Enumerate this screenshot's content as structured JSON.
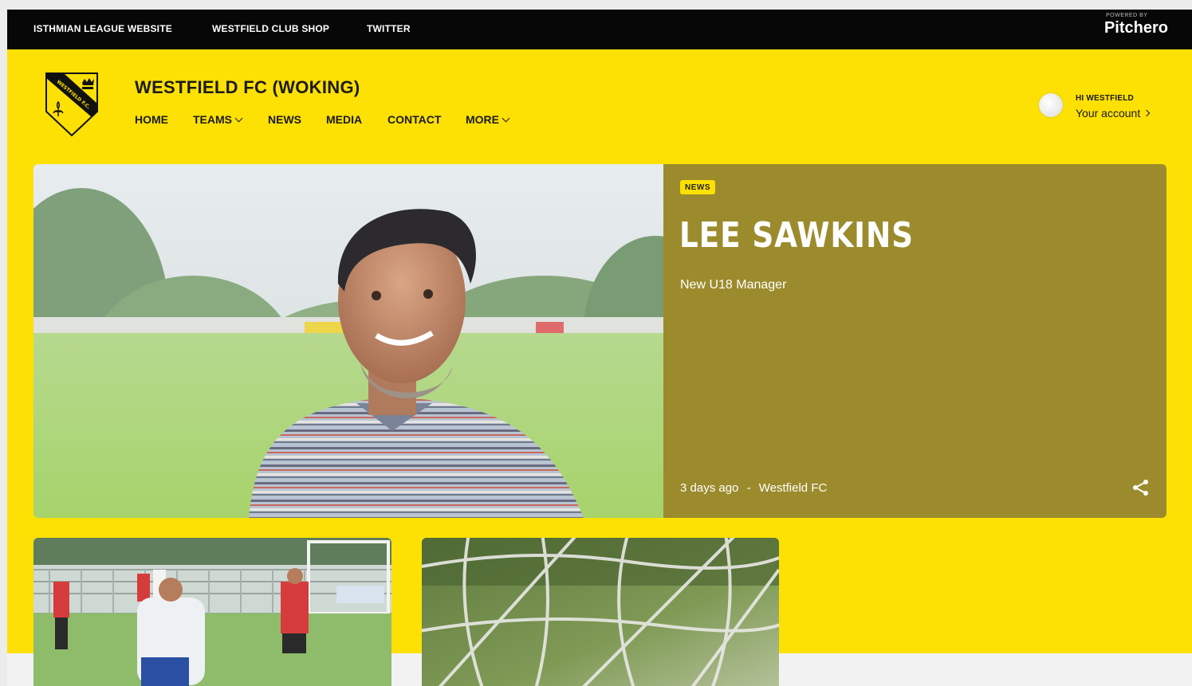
{
  "topbar": {
    "links": [
      "ISTHMIAN LEAGUE WEBSITE",
      "WESTFIELD CLUB SHOP",
      "TWITTER"
    ],
    "powered_by": "POWERED BY",
    "brand": "Pitchero"
  },
  "header": {
    "club_name": "WESTFIELD FC (WOKING)",
    "crest_icon": "club-crest-icon",
    "nav": [
      "HOME",
      "TEAMS",
      "NEWS",
      "MEDIA",
      "CONTACT",
      "MORE"
    ],
    "account_greeting": "HI WESTFIELD",
    "account_link": "Your account"
  },
  "hero": {
    "badge": "NEWS",
    "title": "LEE SAWKINS",
    "subtitle": "New U18 Manager",
    "time": "3 days ago",
    "separator": "-",
    "author": "Westfield FC",
    "share_icon": "share-icon"
  },
  "colors": {
    "brand_yellow": "#fde004",
    "panel_olive": "#9c8b2d",
    "topbar": "#070707"
  }
}
